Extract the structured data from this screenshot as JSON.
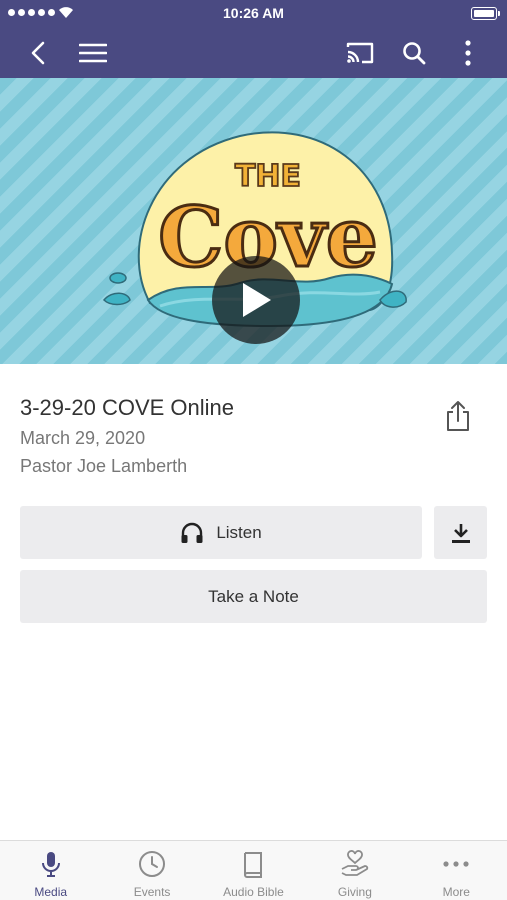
{
  "status_bar": {
    "time": "10:26 AM"
  },
  "app_bar": {
    "icons": [
      "back-icon",
      "menu-icon",
      "cast-icon",
      "search-icon",
      "more-vertical-icon"
    ],
    "color": "#4a4a82"
  },
  "hero": {
    "artwork_text": "THE COVE"
  },
  "media": {
    "title": "3-29-20 COVE Online",
    "date": "March 29, 2020",
    "speaker": "Pastor Joe Lamberth"
  },
  "actions": {
    "listen_label": "Listen",
    "note_label": "Take a Note"
  },
  "tabs": [
    {
      "label": "Media",
      "icon": "microphone-icon",
      "active": true
    },
    {
      "label": "Events",
      "icon": "clock-icon",
      "active": false
    },
    {
      "label": "Audio Bible",
      "icon": "book-icon",
      "active": false
    },
    {
      "label": "Giving",
      "icon": "giving-hand-icon",
      "active": false
    },
    {
      "label": "More",
      "icon": "more-horizontal-icon",
      "active": false
    }
  ],
  "colors": {
    "accent": "#4a4a82",
    "button_bg": "#ececee",
    "hero_bg": "#7ec8d8"
  }
}
